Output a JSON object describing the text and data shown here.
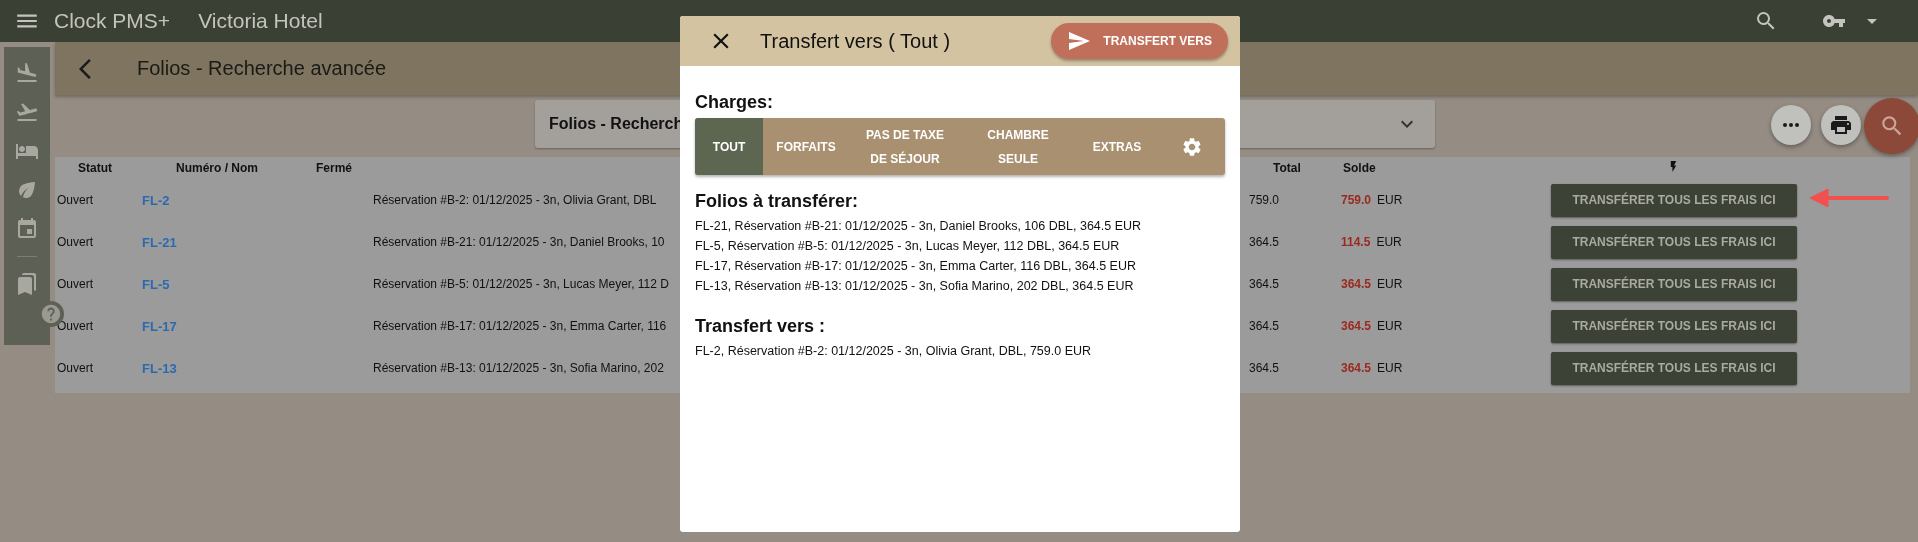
{
  "app_bar": {
    "title": "Clock PMS+",
    "hotel": "Victoria Hotel"
  },
  "page": {
    "title": "Folios - Recherche avancée"
  },
  "search_panel": {
    "title": "Folios - Recherch"
  },
  "table": {
    "columns": [
      "Statut",
      "Numéro / Nom",
      "Fermé",
      "Total",
      "Solde"
    ],
    "rows": [
      {
        "status": "Ouvert",
        "number": "FL-2",
        "description": "Réservation #B-2: 01/12/2025 - 3n, Olivia Grant, DBL",
        "total": "759.0",
        "balance": "759.0",
        "currency": "EUR",
        "action": "TRANSFÉRER TOUS LES FRAIS ICI"
      },
      {
        "status": "Ouvert",
        "number": "FL-21",
        "description": "Réservation #B-21: 01/12/2025 - 3n, Daniel Brooks, 10",
        "total": "364.5",
        "balance": "114.5",
        "currency": "EUR",
        "action": "TRANSFÉRER TOUS LES FRAIS ICI"
      },
      {
        "status": "Ouvert",
        "number": "FL-5",
        "description": "Réservation #B-5: 01/12/2025 - 3n, Lucas Meyer, 112 D",
        "total": "364.5",
        "balance": "364.5",
        "currency": "EUR",
        "action": "TRANSFÉRER TOUS LES FRAIS ICI"
      },
      {
        "status": "Ouvert",
        "number": "FL-17",
        "description": "Réservation #B-17: 01/12/2025 - 3n, Emma Carter, 116",
        "total": "364.5",
        "balance": "364.5",
        "currency": "EUR",
        "action": "TRANSFÉRER TOUS LES FRAIS ICI"
      },
      {
        "status": "Ouvert",
        "number": "FL-13",
        "description": "Réservation #B-13: 01/12/2025 - 3n, Sofia Marino, 202",
        "total": "364.5",
        "balance": "364.5",
        "currency": "EUR",
        "action": "TRANSFÉRER TOUS LES FRAIS ICI"
      }
    ]
  },
  "dialog": {
    "title": "Transfert vers ( Tout )",
    "send_button": "TRANSFERT VERS",
    "charges_label": "Charges:",
    "charge_tabs": [
      {
        "label": "TOUT",
        "selected": true
      },
      {
        "label": "FORFAITS",
        "selected": false
      },
      {
        "label": "PAS DE TAXE DE SÉJOUR",
        "selected": false
      },
      {
        "label": "CHAMBRE SEULE",
        "selected": false
      },
      {
        "label": "EXTRAS",
        "selected": false
      }
    ],
    "folios_label": "Folios à transférer:",
    "folios": [
      "FL-21, Réservation #B-21: 01/12/2025 - 3n, Daniel Brooks, 106 DBL, 364.5 EUR",
      "FL-5, Réservation #B-5: 01/12/2025 - 3n, Lucas Meyer, 112 DBL, 364.5 EUR",
      "FL-17, Réservation #B-17: 01/12/2025 - 3n, Emma Carter, 116 DBL, 364.5 EUR",
      "FL-13, Réservation #B-13: 01/12/2025 - 3n, Sofia Marino, 202 DBL, 364.5 EUR"
    ],
    "target_label": "Transfert vers :",
    "targets": [
      "FL-2, Réservation #B-2: 01/12/2025 - 3n, Olivia Grant, DBL, 759.0 EUR"
    ]
  }
}
